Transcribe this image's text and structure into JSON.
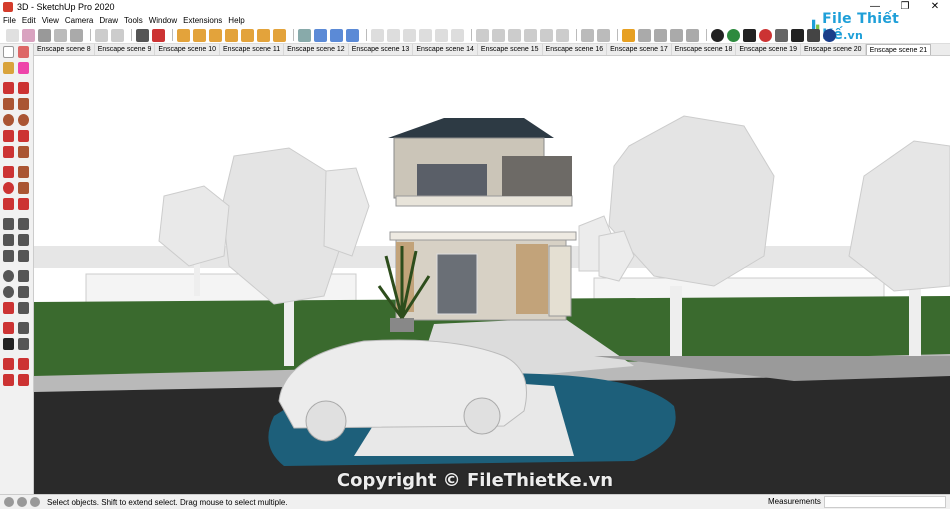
{
  "window": {
    "title": "3D - SketchUp Pro 2020",
    "controls": [
      "—",
      "❐",
      "✕"
    ]
  },
  "menu": [
    "File",
    "Edit",
    "View",
    "Camera",
    "Draw",
    "Tools",
    "Window",
    "Extensions",
    "Help"
  ],
  "scene_tabs": [
    "Enscape scene 8",
    "Enscape scene 9",
    "Enscape scene 10",
    "Enscape scene 11",
    "Enscape scene 12",
    "Enscape scene 13",
    "Enscape scene 14",
    "Enscape scene 15",
    "Enscape scene 16",
    "Enscape scene 17",
    "Enscape scene 18",
    "Enscape scene 19",
    "Enscape scene 20",
    "Enscape scene 21"
  ],
  "active_scene": "Enscape scene 21",
  "logo": {
    "text": "File Thiết Kế",
    "domain": ".vn"
  },
  "status": {
    "hint": "Select objects. Shift to extend select. Drag mouse to select multiple.",
    "measurements_label": "Measurements",
    "measurements_value": ""
  },
  "watermark": "Copyright © FileThietKe.vn",
  "colors": {
    "sky": "#ffffff",
    "grass": "#3a6a2e",
    "road": "#2a2a2a",
    "water": "#1d5f7a",
    "brand": "#1e9fd8"
  }
}
